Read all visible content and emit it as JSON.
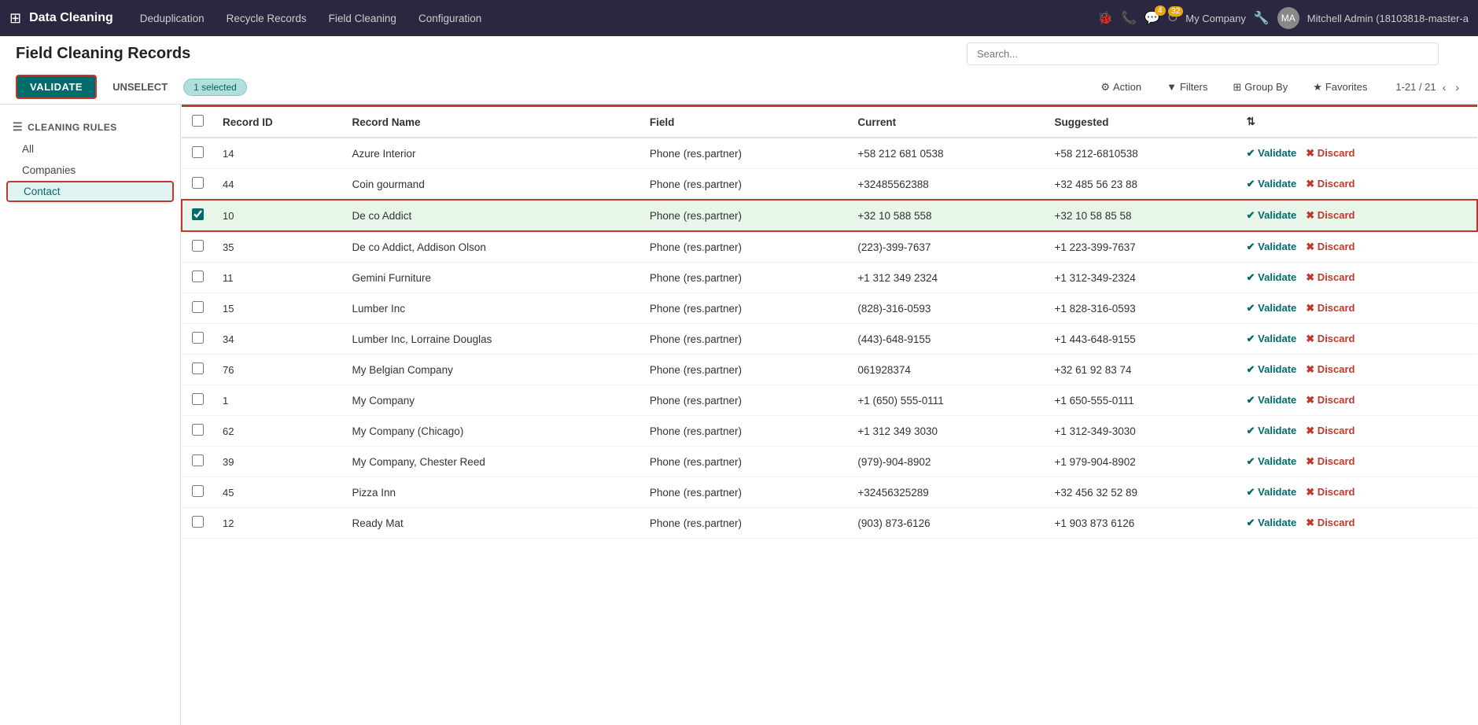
{
  "app": {
    "brand": "Data Cleaning",
    "nav_links": [
      "Deduplication",
      "Recycle Records",
      "Field Cleaning",
      "Configuration"
    ],
    "nav_icons": [
      {
        "name": "bug-icon",
        "symbol": "🐞"
      },
      {
        "name": "phone-icon",
        "symbol": "📞"
      },
      {
        "name": "chat-icon",
        "symbol": "💬",
        "badge": "4"
      },
      {
        "name": "clock-icon",
        "symbol": "⏱",
        "badge": "32"
      }
    ],
    "company": "My Company",
    "username": "Mitchell Admin (18103818-master-a"
  },
  "page": {
    "title": "Field Cleaning Records",
    "search_placeholder": "Search..."
  },
  "toolbar": {
    "validate_label": "VALIDATE",
    "unselect_label": "UNSELECT",
    "selected_label": "1 selected",
    "action_label": "Action",
    "filters_label": "Filters",
    "group_by_label": "Group By",
    "favorites_label": "Favorites",
    "pagination": "1-21 / 21"
  },
  "sidebar": {
    "section_header": "CLEANING RULES",
    "items": [
      {
        "label": "All",
        "active": false
      },
      {
        "label": "Companies",
        "active": false
      },
      {
        "label": "Contact",
        "active": true
      }
    ]
  },
  "table": {
    "columns": [
      "Record ID",
      "Record Name",
      "Field",
      "Current",
      "Suggested",
      ""
    ],
    "rows": [
      {
        "id": "14",
        "name": "Azure Interior",
        "field": "Phone (res.partner)",
        "current": "+58 212 681 0538",
        "suggested": "+58 212-6810538",
        "selected": false
      },
      {
        "id": "44",
        "name": "Coin gourmand",
        "field": "Phone (res.partner)",
        "current": "+32485562388",
        "suggested": "+32 485 56 23 88",
        "selected": false
      },
      {
        "id": "10",
        "name": "De co Addict",
        "field": "Phone (res.partner)",
        "current": "+32 10 588 558",
        "suggested": "+32 10 58 85 58",
        "selected": true
      },
      {
        "id": "35",
        "name": "De co Addict, Addison Olson",
        "field": "Phone (res.partner)",
        "current": "(223)-399-7637",
        "suggested": "+1 223-399-7637",
        "selected": false
      },
      {
        "id": "11",
        "name": "Gemini Furniture",
        "field": "Phone (res.partner)",
        "current": "+1 312 349 2324",
        "suggested": "+1 312-349-2324",
        "selected": false
      },
      {
        "id": "15",
        "name": "Lumber Inc",
        "field": "Phone (res.partner)",
        "current": "(828)-316-0593",
        "suggested": "+1 828-316-0593",
        "selected": false
      },
      {
        "id": "34",
        "name": "Lumber Inc, Lorraine Douglas",
        "field": "Phone (res.partner)",
        "current": "(443)-648-9155",
        "suggested": "+1 443-648-9155",
        "selected": false
      },
      {
        "id": "76",
        "name": "My Belgian Company",
        "field": "Phone (res.partner)",
        "current": "061928374",
        "suggested": "+32 61 92 83 74",
        "selected": false
      },
      {
        "id": "1",
        "name": "My Company",
        "field": "Phone (res.partner)",
        "current": "+1 (650) 555-0111",
        "suggested": "+1 650-555-0111",
        "selected": false
      },
      {
        "id": "62",
        "name": "My Company (Chicago)",
        "field": "Phone (res.partner)",
        "current": "+1 312 349 3030",
        "suggested": "+1 312-349-3030",
        "selected": false
      },
      {
        "id": "39",
        "name": "My Company, Chester Reed",
        "field": "Phone (res.partner)",
        "current": "(979)-904-8902",
        "suggested": "+1 979-904-8902",
        "selected": false
      },
      {
        "id": "45",
        "name": "Pizza Inn",
        "field": "Phone (res.partner)",
        "current": "+32456325289",
        "suggested": "+32 456 32 52 89",
        "selected": false
      },
      {
        "id": "12",
        "name": "Ready Mat",
        "field": "Phone (res.partner)",
        "current": "(903) 873-6126",
        "suggested": "+1 903 873 6126",
        "selected": false
      }
    ]
  }
}
